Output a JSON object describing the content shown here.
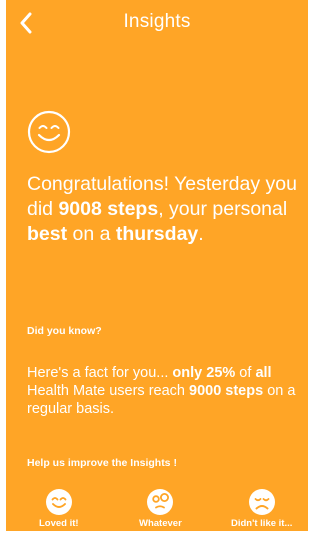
{
  "header": {
    "title": "Insights",
    "back_icon": "chevron-left-icon"
  },
  "colors": {
    "background": "#ffa526",
    "text": "#ffffff"
  },
  "headline": {
    "icon": "smiley-icon",
    "p1": "Congratulations! Yesterday you did ",
    "steps": "9008 steps",
    "p2": ", your personal ",
    "best": "best",
    "p3": " on a ",
    "day": "thursday",
    "p4": "."
  },
  "did_you_know": {
    "label": "Did you know?"
  },
  "fact": {
    "p1": "Here's a fact for you... ",
    "percent": "only 25%",
    "p2": " of ",
    "all": "all",
    "p3": " Health Mate users reach ",
    "steps": "9000 steps",
    "p4": " on a regular basis."
  },
  "feedback": {
    "label": "Help us improve the Insights !",
    "options": [
      {
        "label": "Loved it!",
        "icon": "happy-face-icon"
      },
      {
        "label": "Whatever",
        "icon": "confused-face-icon"
      },
      {
        "label": "Didn't like it...",
        "icon": "sad-face-icon"
      }
    ]
  }
}
